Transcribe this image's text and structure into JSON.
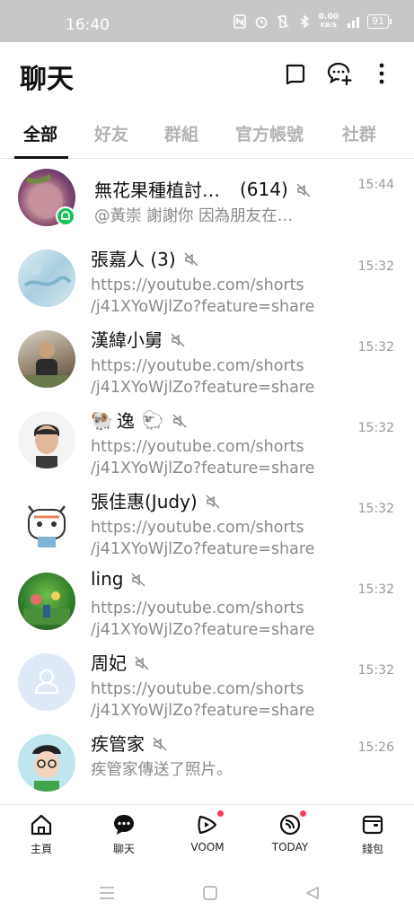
{
  "status_bar": {
    "time": "16:40",
    "speed": "0.00",
    "speed_unit": "KB/S",
    "battery": "91",
    "network": "4G"
  },
  "header": {
    "title": "聊天",
    "icons": [
      "new-chat-square-icon",
      "add-chat-bubble-icon",
      "more-vertical-icon"
    ]
  },
  "tabs": [
    {
      "label": "全部",
      "active": true
    },
    {
      "label": "好友",
      "active": false
    },
    {
      "label": "群組",
      "active": false
    },
    {
      "label": "官方帳號",
      "active": false
    },
    {
      "label": "社群",
      "active": false
    }
  ],
  "chats": [
    {
      "name": "無花果種植討…",
      "count": "(614)",
      "time": "15:44",
      "message": "@黃崇 謝謝你 因為朋友在…",
      "muted": true,
      "avatar": "fig-photo"
    },
    {
      "name": "張嘉人 (3)",
      "time": "15:32",
      "message_line1": "https://youtube.com/shorts",
      "message_line2": "/j41XYoWjlZo?feature=share",
      "muted": true,
      "avatar": "blue-painting"
    },
    {
      "name": "漢緯小舅",
      "time": "15:32",
      "message_line1": "https://youtube.com/shorts",
      "message_line2": "/j41XYoWjlZo?feature=share",
      "muted": true,
      "avatar": "man-outdoor"
    },
    {
      "name_prefix_emoji": "🐏",
      "name": "逸",
      "name_suffix_emoji": "🐑",
      "time": "15:32",
      "message_line1": "https://youtube.com/shorts",
      "message_line2": "/j41XYoWjlZo?feature=share",
      "muted": true,
      "avatar": "man-portrait"
    },
    {
      "name": "張佳惠(Judy)",
      "time": "15:32",
      "message_line1": "https://youtube.com/shorts",
      "message_line2": "/j41XYoWjlZo?feature=share",
      "muted": true,
      "avatar": "cat-cartoon"
    },
    {
      "name": "ling",
      "time": "15:32",
      "message_line1": "https://youtube.com/shorts",
      "message_line2": "/j41XYoWjlZo?feature=share",
      "muted": true,
      "avatar": "green-scene"
    },
    {
      "name": "周妃",
      "time": "15:32",
      "message_line1": "https://youtube.com/shorts",
      "message_line2": "/j41XYoWjlZo?feature=share",
      "muted": true,
      "avatar": "default-person"
    },
    {
      "name": "疾管家",
      "time": "15:26",
      "message": "疾管家傳送了照片。",
      "muted": true,
      "avatar": "cartoon-man"
    }
  ],
  "bottom_nav": [
    {
      "label": "主頁",
      "icon": "home-icon"
    },
    {
      "label": "聊天",
      "icon": "chat-icon",
      "active": true
    },
    {
      "label": "VOOM",
      "icon": "voom-icon",
      "dot": true
    },
    {
      "label": "TODAY",
      "icon": "today-icon",
      "dot": true
    },
    {
      "label": "錢包",
      "icon": "wallet-icon"
    }
  ],
  "colors": {
    "status_bar_bg": "#c7c7c7",
    "accent_green": "#19c45b",
    "notification_red": "#ff3b5c",
    "muted_text": "#8a8a8a"
  }
}
